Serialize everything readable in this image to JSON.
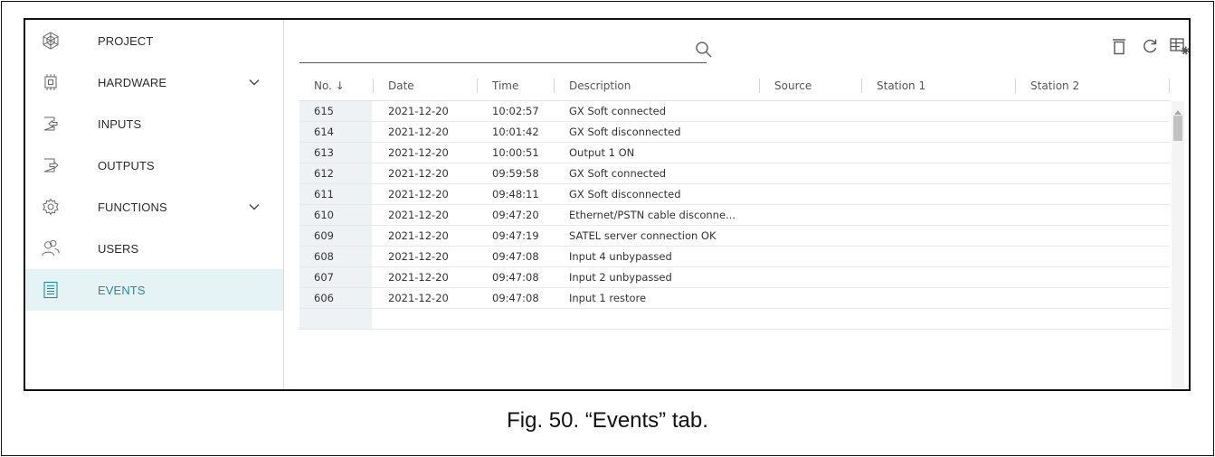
{
  "sidebar": {
    "items": [
      {
        "label": "PROJECT",
        "icon": "project-icon",
        "chevron": false,
        "active": false
      },
      {
        "label": "HARDWARE",
        "icon": "hardware-icon",
        "chevron": true,
        "active": false
      },
      {
        "label": "INPUTS",
        "icon": "inputs-icon",
        "chevron": false,
        "active": false
      },
      {
        "label": "OUTPUTS",
        "icon": "outputs-icon",
        "chevron": false,
        "active": false
      },
      {
        "label": "FUNCTIONS",
        "icon": "gear-icon",
        "chevron": true,
        "active": false
      },
      {
        "label": "USERS",
        "icon": "users-icon",
        "chevron": false,
        "active": false
      },
      {
        "label": "EVENTS",
        "icon": "events-icon",
        "chevron": false,
        "active": true
      }
    ]
  },
  "toolbar": {
    "search_value": "",
    "search_placeholder": "",
    "buttons": [
      "delete-icon",
      "refresh-icon",
      "table-settings-icon"
    ]
  },
  "table": {
    "columns": [
      "No. ↓",
      "Date",
      "Time",
      "Description",
      "Source",
      "Station 1",
      "Station 2"
    ],
    "rows": [
      {
        "no": "615",
        "date": "2021-12-20",
        "time": "10:02:57",
        "description": "GX Soft connected"
      },
      {
        "no": "614",
        "date": "2021-12-20",
        "time": "10:01:42",
        "description": "GX Soft disconnected"
      },
      {
        "no": "613",
        "date": "2021-12-20",
        "time": "10:00:51",
        "description": "Output 1 ON"
      },
      {
        "no": "612",
        "date": "2021-12-20",
        "time": "09:59:58",
        "description": "GX Soft connected"
      },
      {
        "no": "611",
        "date": "2021-12-20",
        "time": "09:48:11",
        "description": "GX Soft disconnected"
      },
      {
        "no": "610",
        "date": "2021-12-20",
        "time": "09:47:20",
        "description": "Ethernet/PSTN cable disconne..."
      },
      {
        "no": "609",
        "date": "2021-12-20",
        "time": "09:47:19",
        "description": "SATEL server connection OK"
      },
      {
        "no": "608",
        "date": "2021-12-20",
        "time": "09:47:08",
        "description": "Input 4 unbypassed"
      },
      {
        "no": "607",
        "date": "2021-12-20",
        "time": "09:47:08",
        "description": "Input 2 unbypassed"
      },
      {
        "no": "606",
        "date": "2021-12-20",
        "time": "09:47:08",
        "description": "Input 1 restore"
      }
    ]
  },
  "caption": "Fig. 50. “Events” tab.",
  "colors": {
    "accent": "#1f8f99",
    "active_bg": "#e6f3f4",
    "no_cell_bg": "#eef2f5"
  }
}
